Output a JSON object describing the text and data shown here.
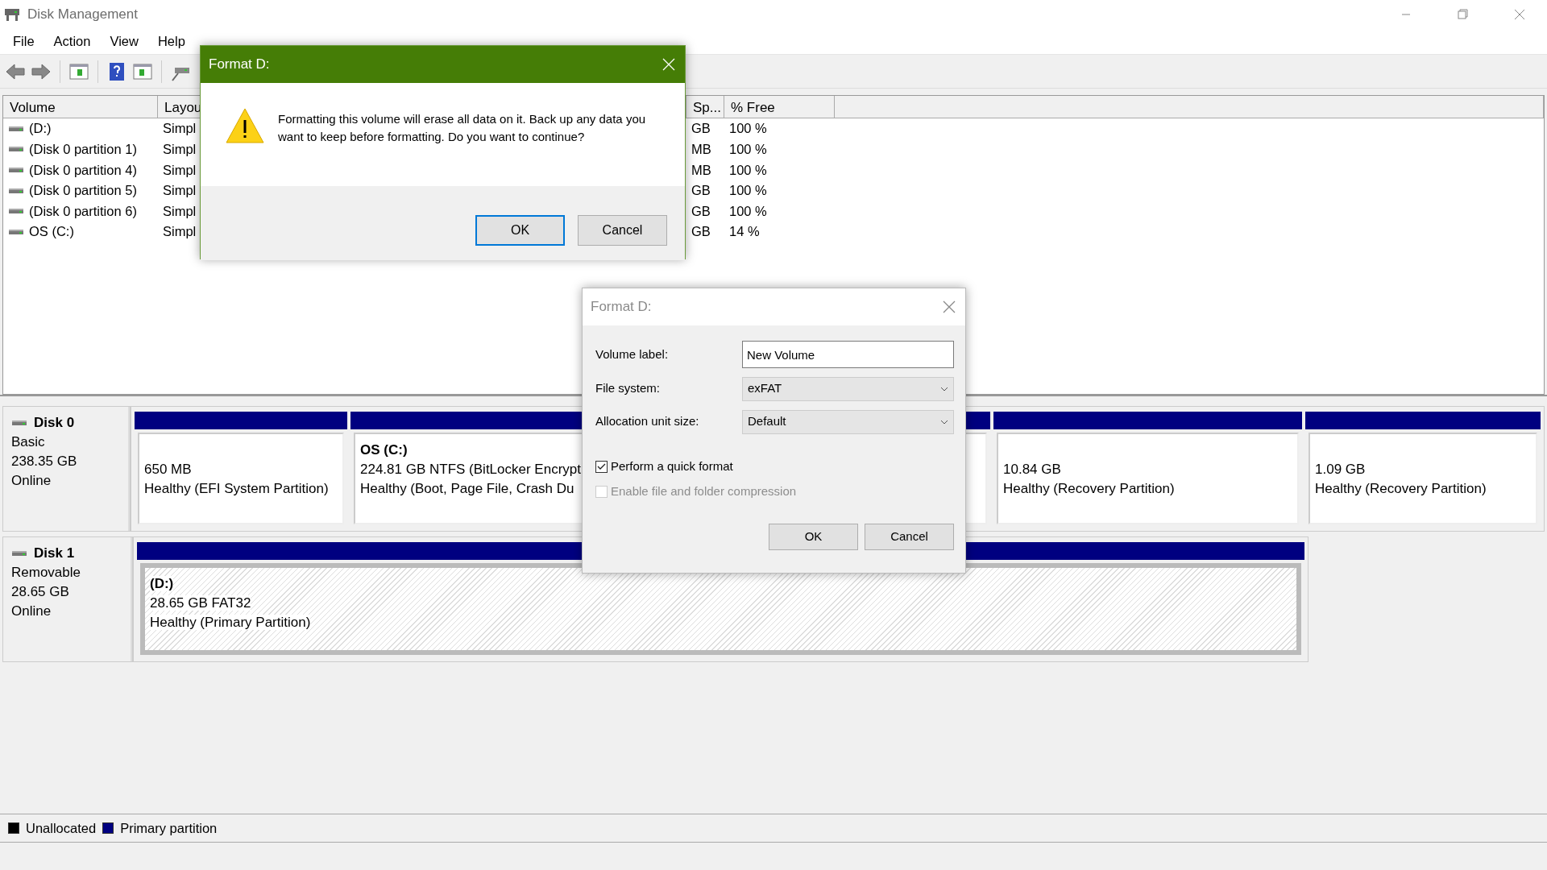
{
  "window": {
    "title": "Disk Management"
  },
  "menu": [
    "File",
    "Action",
    "View",
    "Help"
  ],
  "volume_table": {
    "columns": [
      "Volume",
      "Layou",
      "Sp...",
      "% Free"
    ],
    "rows": [
      {
        "volume": "(D:)",
        "layout": "Simpl",
        "column_3": "GB",
        "free": "100 %"
      },
      {
        "volume": "(Disk 0 partition 1)",
        "layout": "Simpl",
        "column_3": "MB",
        "free": "100 %"
      },
      {
        "volume": "(Disk 0 partition 4)",
        "layout": "Simpl",
        "column_3": "MB",
        "free": "100 %"
      },
      {
        "volume": "(Disk 0 partition 5)",
        "layout": "Simpl",
        "column_3": "GB",
        "free": "100 %"
      },
      {
        "volume": "(Disk 0 partition 6)",
        "layout": "Simpl",
        "column_3": "GB",
        "free": "100 %"
      },
      {
        "volume": "OS (C:)",
        "layout": "Simpl",
        "column_3": "GB",
        "free": "14 %"
      }
    ]
  },
  "disks": [
    {
      "name": "Disk 0",
      "type": "Basic",
      "size": "238.35 GB",
      "status": "Online",
      "partitions": [
        {
          "kind": "primary",
          "selected": false,
          "size": "650 MB",
          "health": "Healthy (EFI System Partition)"
        },
        {
          "kind": "primary",
          "selected": false,
          "title": "OS  (C:)",
          "size": "224.81 GB NTFS (BitLocker Encrypt",
          "health": "Healthy (Boot, Page File, Crash Du"
        },
        {
          "kind": "primary",
          "selected": false
        },
        {
          "kind": "primary",
          "selected": false,
          "size": "10.84 GB",
          "health": "Healthy (Recovery Partition)"
        },
        {
          "kind": "primary",
          "selected": false,
          "size": "1.09 GB",
          "health": "Healthy (Recovery Partition)"
        }
      ]
    },
    {
      "name": "Disk 1",
      "type": "Removable",
      "size": "28.65 GB",
      "status": "Online",
      "partitions": [
        {
          "kind": "primary",
          "selected": true,
          "title": "(D:)",
          "size": "28.65 GB FAT32",
          "health": "Healthy (Primary Partition)"
        }
      ]
    }
  ],
  "legend": [
    {
      "label": "Unallocated",
      "color": "#000000"
    },
    {
      "label": "Primary partition",
      "color": "#000080"
    }
  ],
  "confirm_dialog": {
    "title": "Format D:",
    "active": true,
    "message": "Formatting this volume will erase all data on it. Back up any data you want to keep before formatting. Do you want to continue?",
    "buttons": [
      {
        "label": "OK",
        "default": true
      },
      {
        "label": "Cancel",
        "default": false
      }
    ]
  },
  "format_dialog": {
    "title": "Format D:",
    "active": false,
    "fields": [
      {
        "label": "Volume label:",
        "kind": "text",
        "value": "New Volume"
      },
      {
        "label": "File system:",
        "kind": "select",
        "value": "exFAT"
      },
      {
        "label": "Allocation unit size:",
        "kind": "select",
        "value": "Default"
      }
    ],
    "options": [
      {
        "label": "Perform a quick format",
        "checked": true,
        "disabled": false
      },
      {
        "label": "Enable file and folder compression",
        "checked": false,
        "disabled": true
      }
    ],
    "buttons": [
      {
        "label": "OK",
        "default": false
      },
      {
        "label": "Cancel",
        "default": false
      }
    ]
  }
}
